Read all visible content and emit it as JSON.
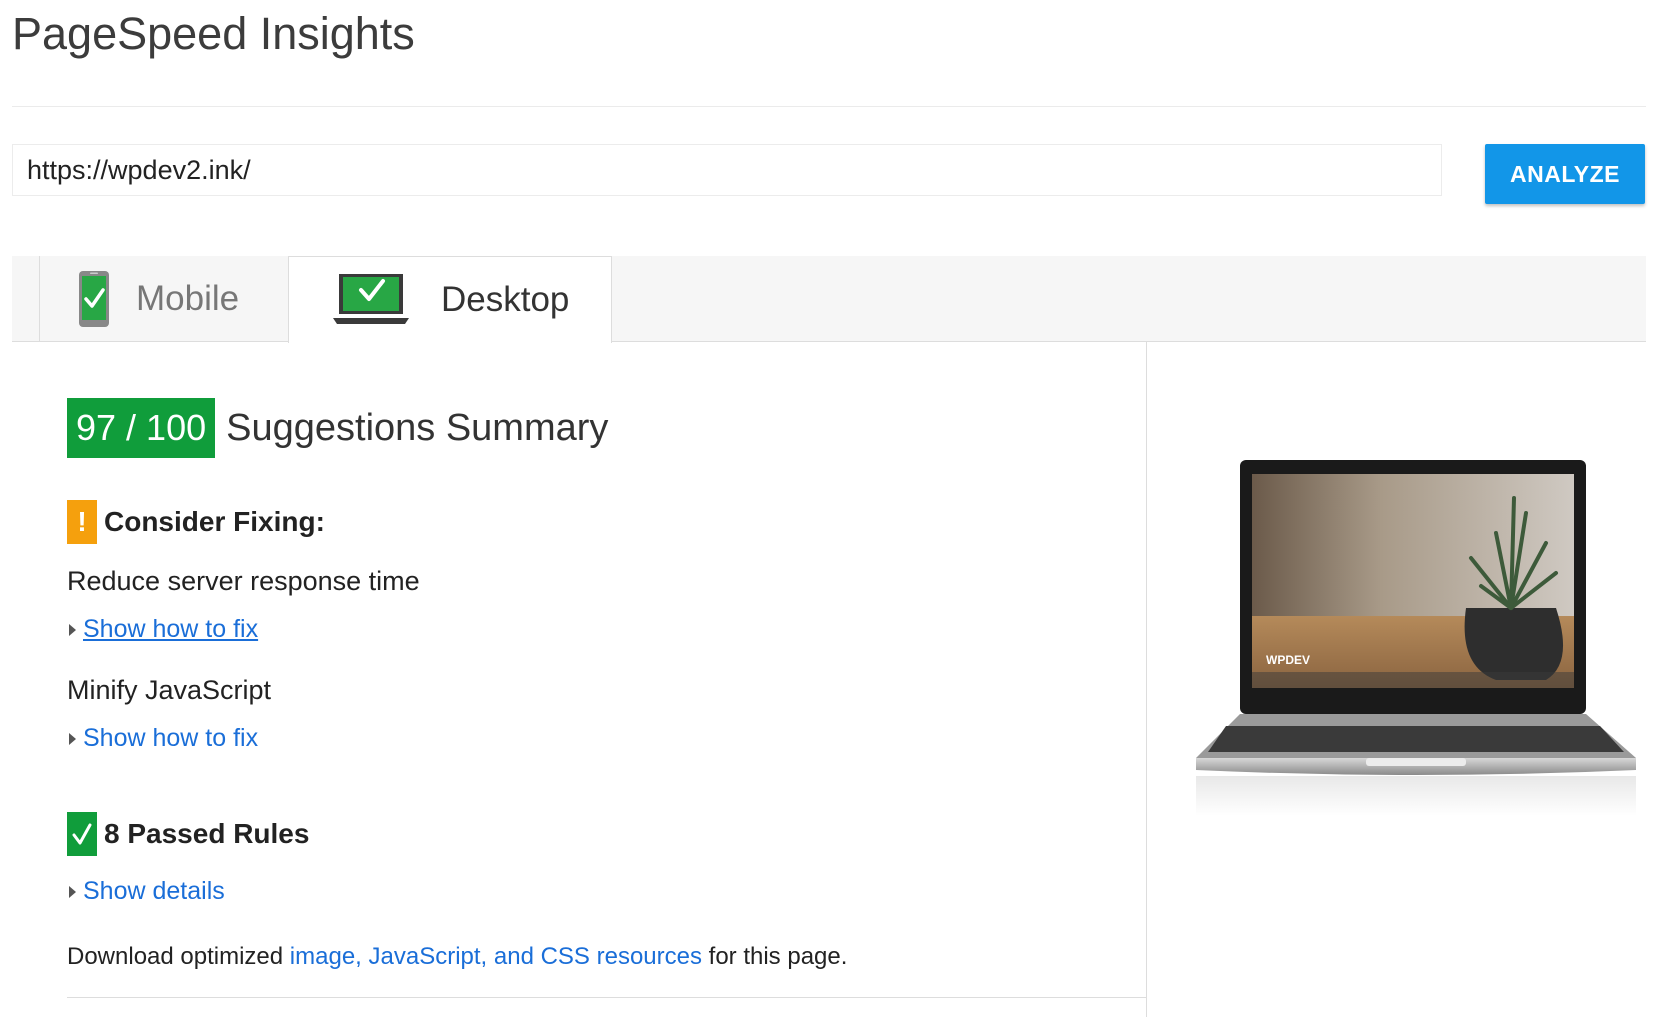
{
  "header": {
    "title": "PageSpeed Insights"
  },
  "url_bar": {
    "value": "https://wpdev2.ink/",
    "analyze_label": "ANALYZE"
  },
  "tabs": [
    {
      "label": "Mobile",
      "selected": false,
      "icon": "mobile-check-icon"
    },
    {
      "label": "Desktop",
      "selected": true,
      "icon": "desktop-check-icon"
    }
  ],
  "summary": {
    "score": "97 / 100",
    "title": "Suggestions Summary",
    "score_color": "#109d3b"
  },
  "consider_fixing": {
    "title": "Consider Fixing:",
    "icon_glyph": "!",
    "icon_color": "#f5a00d",
    "rules": [
      {
        "name": "Reduce server response time",
        "link": "Show how to fix"
      },
      {
        "name": "Minify JavaScript",
        "link": "Show how to fix"
      }
    ]
  },
  "passed": {
    "title": "8 Passed Rules",
    "link": "Show details"
  },
  "download": {
    "prefix": "Download optimized",
    "link": "image, JavaScript, and CSS resources",
    "suffix": "for this page."
  },
  "preview": {
    "screen_label": "WPDEV"
  },
  "colors": {
    "accent": "#1296e8",
    "link": "#1a6ed8",
    "pass": "#109d3b",
    "warn": "#f5a00d"
  }
}
